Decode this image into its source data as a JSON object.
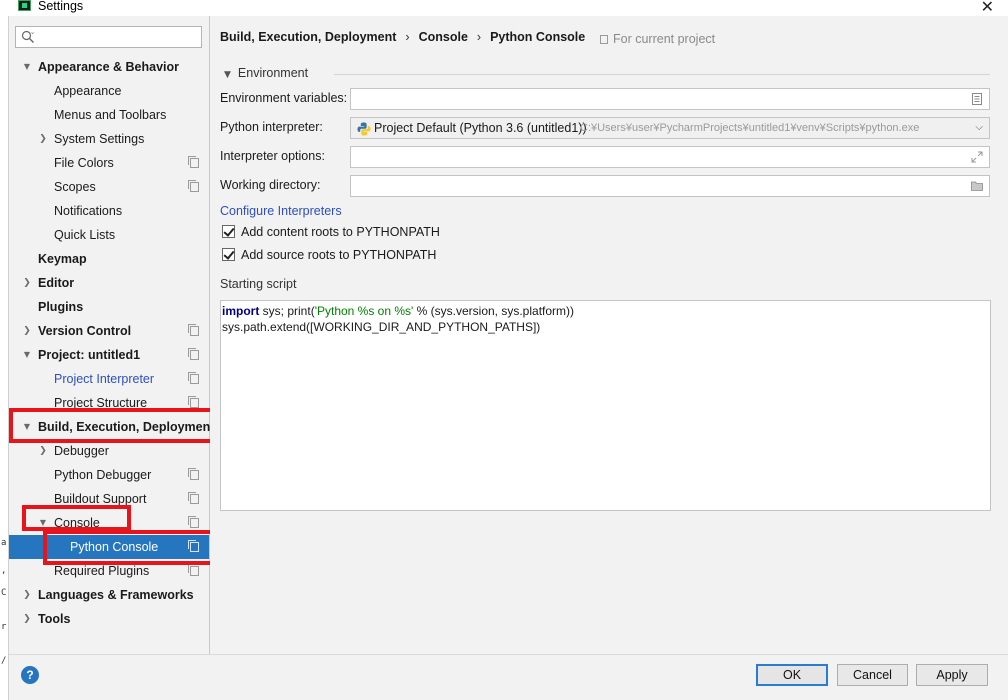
{
  "window": {
    "title": "Settings"
  },
  "search": {
    "placeholder": ""
  },
  "sidebar": {
    "items": [
      {
        "label": "Appearance & Behavior",
        "bold": true,
        "arrow": "▾",
        "level": 0
      },
      {
        "label": "Appearance",
        "level": 1
      },
      {
        "label": "Menus and Toolbars",
        "level": 1
      },
      {
        "label": "System Settings",
        "arrow": "›",
        "level": 1
      },
      {
        "label": "File Colors",
        "level": 1,
        "copy": true
      },
      {
        "label": "Scopes",
        "level": 1,
        "copy": true
      },
      {
        "label": "Notifications",
        "level": 1
      },
      {
        "label": "Quick Lists",
        "level": 1
      },
      {
        "label": "Keymap",
        "bold": true,
        "level": 0
      },
      {
        "label": "Editor",
        "bold": true,
        "arrow": "›",
        "level": 0
      },
      {
        "label": "Plugins",
        "bold": true,
        "level": 0
      },
      {
        "label": "Version Control",
        "bold": true,
        "arrow": "›",
        "level": 0,
        "copy": true
      },
      {
        "label": "Project: untitled1",
        "bold": true,
        "arrow": "▾",
        "level": 0,
        "copy": true
      },
      {
        "label": "Project Interpreter",
        "link": true,
        "level": 1,
        "copy": true
      },
      {
        "label": "Project Structure",
        "level": 1,
        "copy": true
      },
      {
        "label": "Build, Execution, Deployment",
        "bold": true,
        "arrow": "▾",
        "level": 0
      },
      {
        "label": "Debugger",
        "arrow": "›",
        "level": 1
      },
      {
        "label": "Python Debugger",
        "level": 1,
        "copy": true
      },
      {
        "label": "Buildout Support",
        "level": 1,
        "copy": true
      },
      {
        "label": "Console",
        "arrow": "▾",
        "level": 1,
        "copy": true
      },
      {
        "label": "Python Console",
        "level": 2,
        "copy": true,
        "selected": true
      },
      {
        "label": "Required Plugins",
        "level": 1,
        "copy": true
      },
      {
        "label": "Languages & Frameworks",
        "bold": true,
        "arrow": "›",
        "level": 0
      },
      {
        "label": "Tools",
        "bold": true,
        "arrow": "›",
        "level": 0
      }
    ]
  },
  "breadcrumb": {
    "part1": "Build, Execution, Deployment",
    "part2": "Console",
    "part3": "Python Console",
    "sep": "›"
  },
  "for_project": "For current project",
  "environment": {
    "section": "Environment",
    "env_vars_label": "Environment variables:",
    "env_vars_value": "",
    "interpreter_label": "Python interpreter:",
    "interpreter_name": "Project Default (Python 3.6 (untitled1))",
    "interpreter_path": "C:¥Users¥user¥PycharmProjects¥untitled1¥venv¥Scripts¥python.exe",
    "options_label": "Interpreter options:",
    "options_value": "",
    "workdir_label": "Working directory:",
    "workdir_value": ""
  },
  "configure_link": "Configure Interpreters",
  "checkboxes": {
    "content_roots": {
      "label": "Add content roots to PYTHONPATH",
      "checked": true
    },
    "source_roots": {
      "label": "Add source roots to PYTHONPATH",
      "checked": true
    }
  },
  "script": {
    "label": "Starting script",
    "line1_kw": "import",
    "line1_a": " sys; print(",
    "line1_str": "'Python %s on %s'",
    "line1_b": " % (sys.version, sys.platform))",
    "line2": "sys.path.extend([WORKING_DIR_AND_PYTHON_PATHS])"
  },
  "buttons": {
    "help": "?",
    "ok": "OK",
    "cancel": "Cancel",
    "apply": "Apply"
  },
  "underlay_chars": [
    "a",
    ",",
    "C",
    "r",
    "/"
  ],
  "colors": {
    "selection": "#2675bf",
    "highlight": "#e8141b",
    "link": "#2d4fbf"
  }
}
